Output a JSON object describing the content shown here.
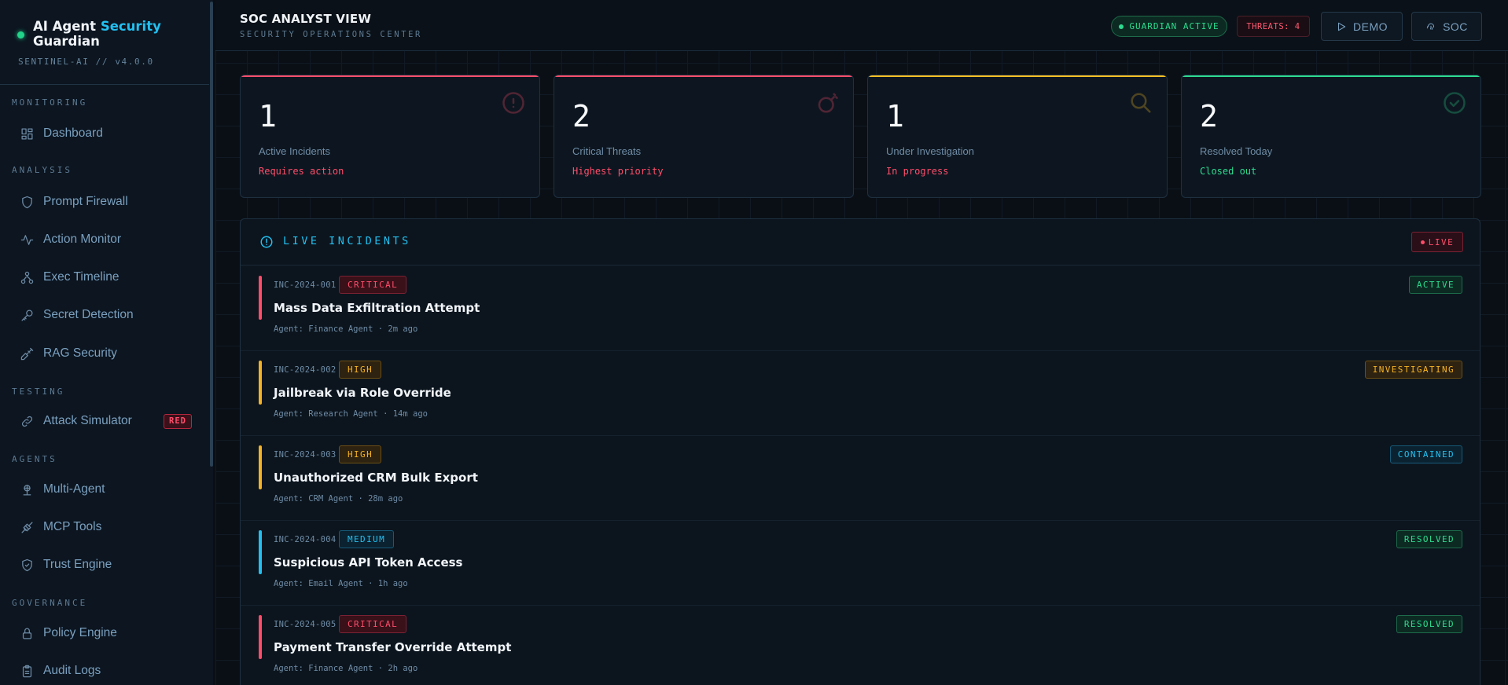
{
  "brand": {
    "title_main": "AI Agent",
    "title_accent": "Security",
    "title_second_line": "Guardian",
    "version": "SENTINEL-AI // v4.0.0"
  },
  "sidebar": {
    "sections": [
      {
        "label": "MONITORING",
        "items": [
          {
            "label": "Dashboard",
            "icon": "dashboard-icon"
          }
        ]
      },
      {
        "label": "ANALYSIS",
        "items": [
          {
            "label": "Prompt Firewall",
            "icon": "shield-icon"
          },
          {
            "label": "Action Monitor",
            "icon": "activity-icon"
          },
          {
            "label": "Exec Timeline",
            "icon": "workflow-icon"
          },
          {
            "label": "Secret Detection",
            "icon": "key-icon"
          },
          {
            "label": "RAG Security",
            "icon": "syringe-icon"
          }
        ]
      },
      {
        "label": "TESTING",
        "items": [
          {
            "label": "Attack Simulator",
            "icon": "link-icon",
            "badge": "RED"
          }
        ]
      },
      {
        "label": "AGENTS",
        "items": [
          {
            "label": "Multi-Agent",
            "icon": "network-icon"
          },
          {
            "label": "MCP Tools",
            "icon": "plug-icon"
          },
          {
            "label": "Trust Engine",
            "icon": "shield-check-icon"
          }
        ]
      },
      {
        "label": "GOVERNANCE",
        "items": [
          {
            "label": "Policy Engine",
            "icon": "lock-icon"
          },
          {
            "label": "Audit Logs",
            "icon": "clipboard-icon"
          }
        ]
      }
    ]
  },
  "header": {
    "title": "SOC ANALYST VIEW",
    "subtitle": "SECURITY OPERATIONS CENTER",
    "guardian_status": "GUARDIAN ACTIVE",
    "threats": "THREATS: 4",
    "demo_label": "DEMO",
    "soc_label": "SOC"
  },
  "stats": [
    {
      "value": "1",
      "label": "Active Incidents",
      "sub": "Requires action",
      "color": "#ff4d6a",
      "icon": "alert-circle-icon"
    },
    {
      "value": "2",
      "label": "Critical Threats",
      "sub": "Highest priority",
      "color": "#ff4d6a",
      "icon": "bomb-icon"
    },
    {
      "value": "1",
      "label": "Under Investigation",
      "sub": "In progress",
      "color": "#fbbf24",
      "icon": "search-icon"
    },
    {
      "value": "2",
      "label": "Resolved Today",
      "sub": "Closed out",
      "color": "#2ddb8f",
      "icon": "check-circle-icon"
    }
  ],
  "incidents_panel": {
    "title": "LIVE INCIDENTS",
    "live_label": "LIVE",
    "incidents": [
      {
        "id": "INC-2024-001",
        "severity": "CRITICAL",
        "title": "Mass Data Exfiltration Attempt",
        "meta": "Agent: Finance Agent · 2m ago",
        "status": "ACTIVE"
      },
      {
        "id": "INC-2024-002",
        "severity": "HIGH",
        "title": "Jailbreak via Role Override",
        "meta": "Agent: Research Agent · 14m ago",
        "status": "INVESTIGATING"
      },
      {
        "id": "INC-2024-003",
        "severity": "HIGH",
        "title": "Unauthorized CRM Bulk Export",
        "meta": "Agent: CRM Agent · 28m ago",
        "status": "CONTAINED"
      },
      {
        "id": "INC-2024-004",
        "severity": "MEDIUM",
        "title": "Suspicious API Token Access",
        "meta": "Agent: Email Agent · 1h ago",
        "status": "RESOLVED"
      },
      {
        "id": "INC-2024-005",
        "severity": "CRITICAL",
        "title": "Payment Transfer Override Attempt",
        "meta": "Agent: Finance Agent · 2h ago",
        "status": "RESOLVED"
      }
    ]
  },
  "colors": {
    "critical": "#ff4d6a",
    "high": "#f5b324",
    "medium": "#22c0f0",
    "active": "#2ddb8f",
    "investigating": "#f5b324",
    "contained": "#22c0f0",
    "resolved": "#2ddb8f"
  }
}
